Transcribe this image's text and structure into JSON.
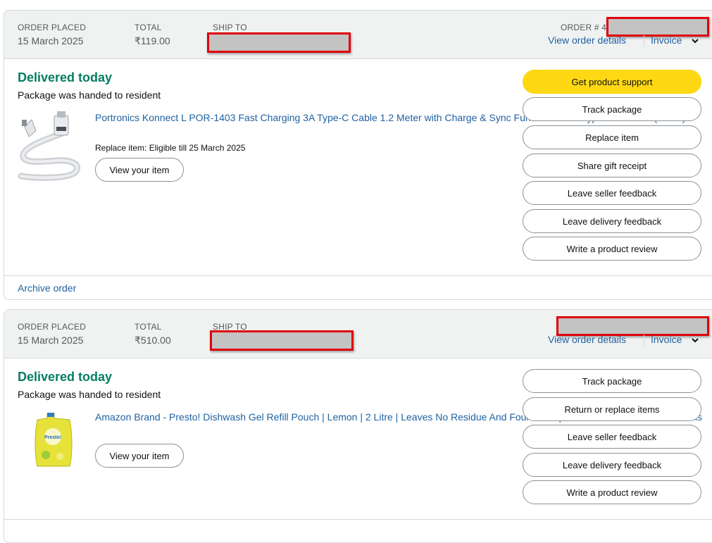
{
  "orders": [
    {
      "order_placed_label": "ORDER PLACED",
      "order_placed_date": "15 March 2025",
      "total_label": "TOTAL",
      "total_value": "₹119.00",
      "ship_to_label": "SHIP TO",
      "order_number_label": "ORDER # 4",
      "view_details": "View order details",
      "invoice": "Invoice",
      "status": "Delivered today",
      "substatus": "Package was handed to resident",
      "item_title": "Portronics Konnect L POR-1403 Fast Charging 3A Type-C Cable 1.2 Meter with Charge & Sync Function for All Type-C Devices (White)",
      "item_note": "Replace item: Eligible till 25 March 2025",
      "view_item": "View your item",
      "actions": [
        "Get product support",
        "Track package",
        "Replace item",
        "Share gift receipt",
        "Leave seller feedback",
        "Leave delivery feedback",
        "Write a product review"
      ],
      "archive": "Archive order"
    },
    {
      "order_placed_label": "ORDER PLACED",
      "order_placed_date": "15 March 2025",
      "total_label": "TOTAL",
      "total_value": "₹510.00",
      "ship_to_label": "SHIP TO",
      "view_details": "View order details",
      "invoice": "Invoice",
      "status": "Delivered today",
      "substatus": "Package was handed to resident",
      "item_title": "Amazon Brand - Presto! Dishwash Gel Refill Pouch | Lemon | 2 Litre | Leaves No Residue And Foul Smell | Grease Cleaner For All Utensils",
      "view_item": "View your item",
      "actions": [
        "Track package",
        "Return or replace items",
        "Leave seller feedback",
        "Leave delivery feedback",
        "Write a product review"
      ]
    }
  ],
  "product_image_text": "Presto!",
  "colors": {
    "accent_green": "#067d62",
    "link_blue": "#2162a1",
    "primary_yellow": "#ffd814",
    "redaction_red": "#e0000b",
    "header_bg": "#f0f2f2"
  },
  "icons": [
    "chevron-down-icon",
    "cable-product-image",
    "dishwash-pouch-product-image"
  ]
}
